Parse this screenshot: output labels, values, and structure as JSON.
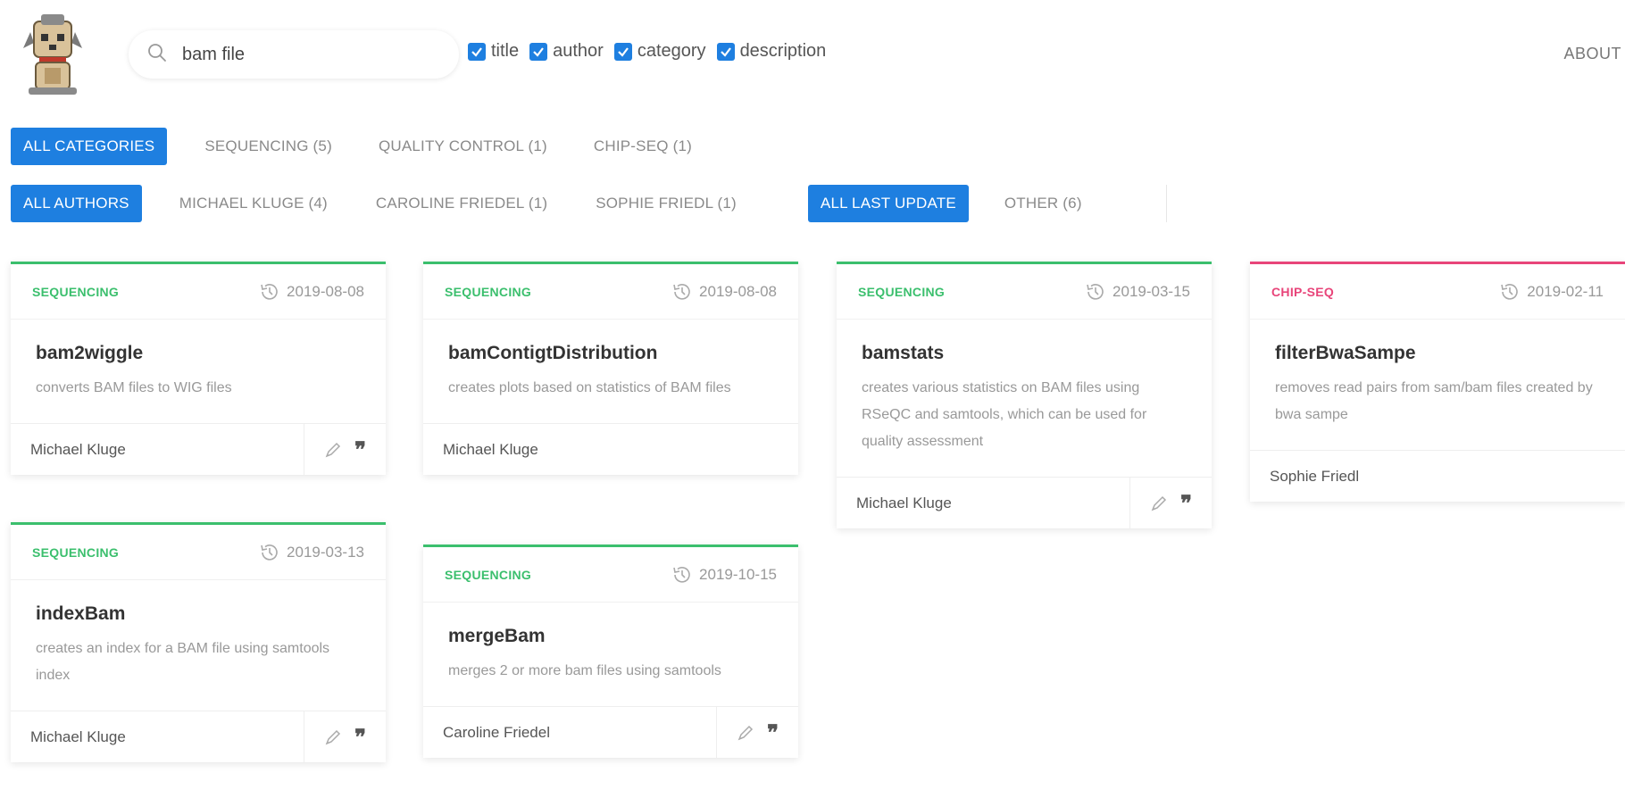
{
  "search": {
    "value": "bam file"
  },
  "filters": [
    {
      "label": "title",
      "checked": true
    },
    {
      "label": "author",
      "checked": true
    },
    {
      "label": "category",
      "checked": true
    },
    {
      "label": "description",
      "checked": true
    }
  ],
  "nav": {
    "about": "ABOUT"
  },
  "categories": [
    {
      "label": "ALL CATEGORIES",
      "active": true
    },
    {
      "label": "SEQUENCING (5)",
      "active": false
    },
    {
      "label": "QUALITY CONTROL (1)",
      "active": false
    },
    {
      "label": "CHIP-SEQ (1)",
      "active": false
    }
  ],
  "authors": [
    {
      "label": "ALL AUTHORS",
      "active": true
    },
    {
      "label": "MICHAEL KLUGE (4)",
      "active": false
    },
    {
      "label": "CAROLINE FRIEDEL (1)",
      "active": false
    },
    {
      "label": "SOPHIE FRIEDL (1)",
      "active": false
    }
  ],
  "updates": [
    {
      "label": "ALL LAST UPDATE",
      "active": true
    },
    {
      "label": "OTHER (6)",
      "active": false
    }
  ],
  "cards": [
    {
      "category": "SEQUENCING",
      "date": "2019-08-08",
      "title": "bam2wiggle",
      "desc": "converts BAM files to WIG files",
      "author": "Michael Kluge",
      "actions": true
    },
    {
      "category": "SEQUENCING",
      "date": "2019-08-08",
      "title": "bamContigtDistribution",
      "desc": "creates plots based on statistics of BAM files",
      "author": "Michael Kluge",
      "actions": false
    },
    {
      "category": "SEQUENCING",
      "date": "2019-03-15",
      "title": "bamstats",
      "desc": "creates various statistics on BAM files using RSeQC and samtools, which can be used for quality assessment",
      "author": "Michael Kluge",
      "actions": true
    },
    {
      "category": "CHIP-SEQ",
      "date": "2019-02-11",
      "title": "filterBwaSampe",
      "desc": "removes read pairs from sam/bam files created by bwa sampe",
      "author": "Sophie Friedl",
      "actions": false
    },
    {
      "category": "SEQUENCING",
      "date": "2019-03-13",
      "title": "indexBam",
      "desc": "creates an index for a BAM file using samtools index",
      "author": "Michael Kluge",
      "actions": true
    },
    {
      "category": "SEQUENCING",
      "date": "2019-10-15",
      "title": "mergeBam",
      "desc": "merges 2 or more bam files using samtools",
      "author": "Caroline Friedel",
      "actions": true
    }
  ],
  "colors": {
    "accent": "#1e7fe0",
    "sequencing": "#3bbf6d",
    "chip_seq": "#e8457a"
  }
}
